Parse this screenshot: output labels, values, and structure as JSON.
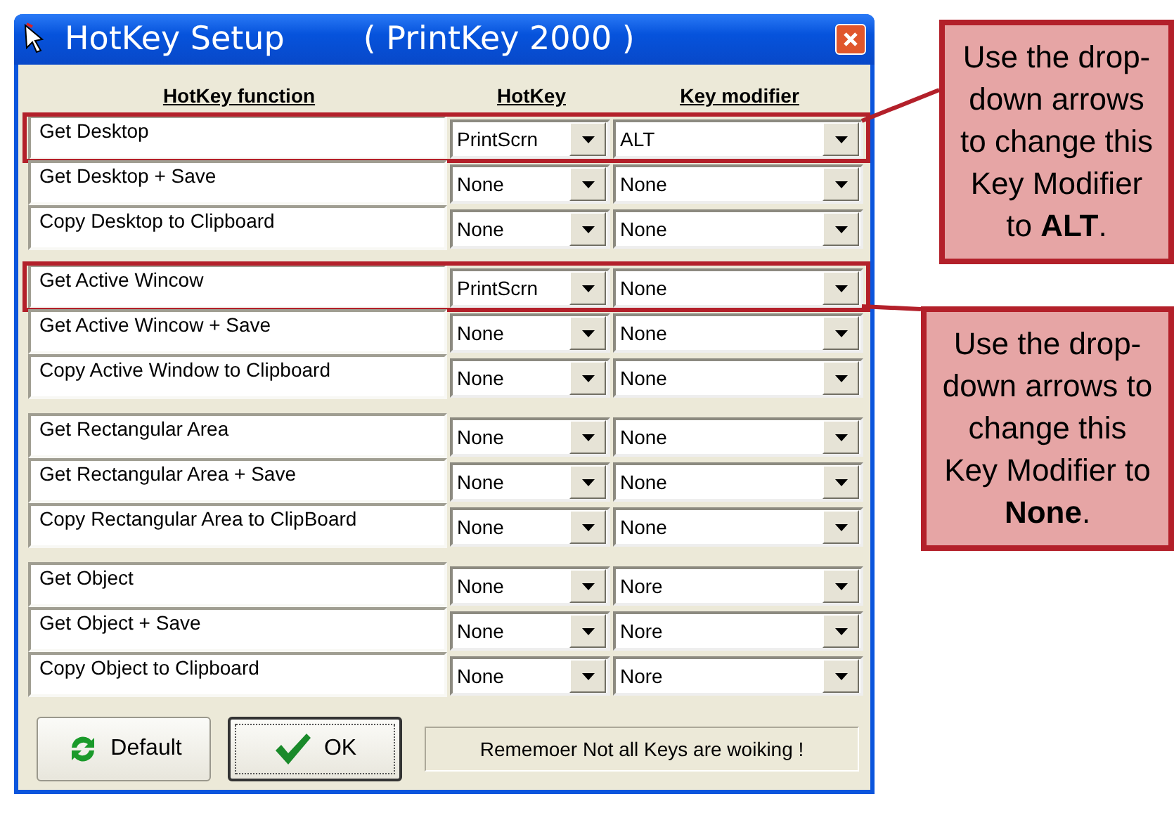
{
  "window": {
    "title": "HotKey Setup",
    "subtitle": "( PrintKey 2000 )"
  },
  "columns": [
    "HotKey function",
    "HotKey",
    "Key modifier"
  ],
  "groups": [
    {
      "rows": [
        {
          "function": "Get Desktop",
          "hotkey": "PrintScrn",
          "modifier": "ALT",
          "highlighted": true
        },
        {
          "function": "Get Desktop + Save",
          "hotkey": "None",
          "modifier": "None",
          "highlighted": false
        },
        {
          "function": "Copy Desktop to Clipboard",
          "hotkey": "None",
          "modifier": "None",
          "highlighted": false
        }
      ]
    },
    {
      "rows": [
        {
          "function": "Get Active Wincow",
          "hotkey": "PrintScrn",
          "modifier": "None",
          "highlighted": true
        },
        {
          "function": "Get Active Wincow + Save",
          "hotkey": "None",
          "modifier": "None",
          "highlighted": false
        },
        {
          "function": "Copy Active Window to Clipboard",
          "hotkey": "None",
          "modifier": "None",
          "highlighted": false
        }
      ]
    },
    {
      "rows": [
        {
          "function": "Get Rectangular Area",
          "hotkey": "None",
          "modifier": "None",
          "highlighted": false
        },
        {
          "function": "Get Rectangular Area + Save",
          "hotkey": "None",
          "modifier": "None",
          "highlighted": false
        },
        {
          "function": "Copy Rectangular Area to ClipBoard",
          "hotkey": "None",
          "modifier": "None",
          "highlighted": false
        }
      ]
    },
    {
      "rows": [
        {
          "function": "Get Object",
          "hotkey": "None",
          "modifier": "Nore",
          "highlighted": false
        },
        {
          "function": "Get Object + Save",
          "hotkey": "None",
          "modifier": "Nore",
          "highlighted": false
        },
        {
          "function": "Copy Object to Clipboard",
          "hotkey": "None",
          "modifier": "Nore",
          "highlighted": false
        }
      ]
    }
  ],
  "buttons": [
    {
      "label": "Default",
      "kind": "refresh",
      "focused": false
    },
    {
      "label": "OK",
      "kind": "check",
      "focused": true
    }
  ],
  "status": "Rememoer Not all  Keys are woiking !",
  "callouts": [
    {
      "text": "Use the drop-down arrows to change this Key Modifier to **ALT**."
    },
    {
      "text": "Use the drop-down arrows to change this Key Modifier to **None**."
    }
  ]
}
